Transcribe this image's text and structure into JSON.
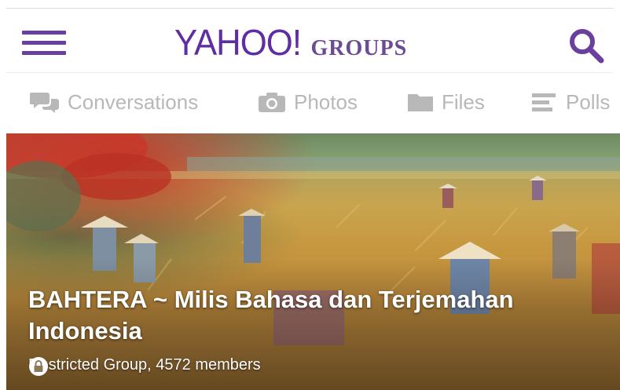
{
  "header": {
    "logo_yahoo": "YAHOO!",
    "logo_groups": "GROUPS",
    "menu_icon": "hamburger-menu-icon",
    "search_icon": "search-icon"
  },
  "tabs": [
    {
      "label": "Conversations",
      "icon": "chat-bubbles-icon"
    },
    {
      "label": "Photos",
      "icon": "camera-icon"
    },
    {
      "label": "Files",
      "icon": "folder-icon"
    },
    {
      "label": "Polls",
      "icon": "polls-icon"
    }
  ],
  "group": {
    "title": "BAHTERA ~ Milis Bahasa dan Terjemahan Indonesia",
    "meta": "Restricted Group, 4572 members",
    "meta_icon": "lock-icon"
  },
  "colors": {
    "brand_purple": "#5f2ea3",
    "tab_inactive": "#b8b8b8"
  }
}
